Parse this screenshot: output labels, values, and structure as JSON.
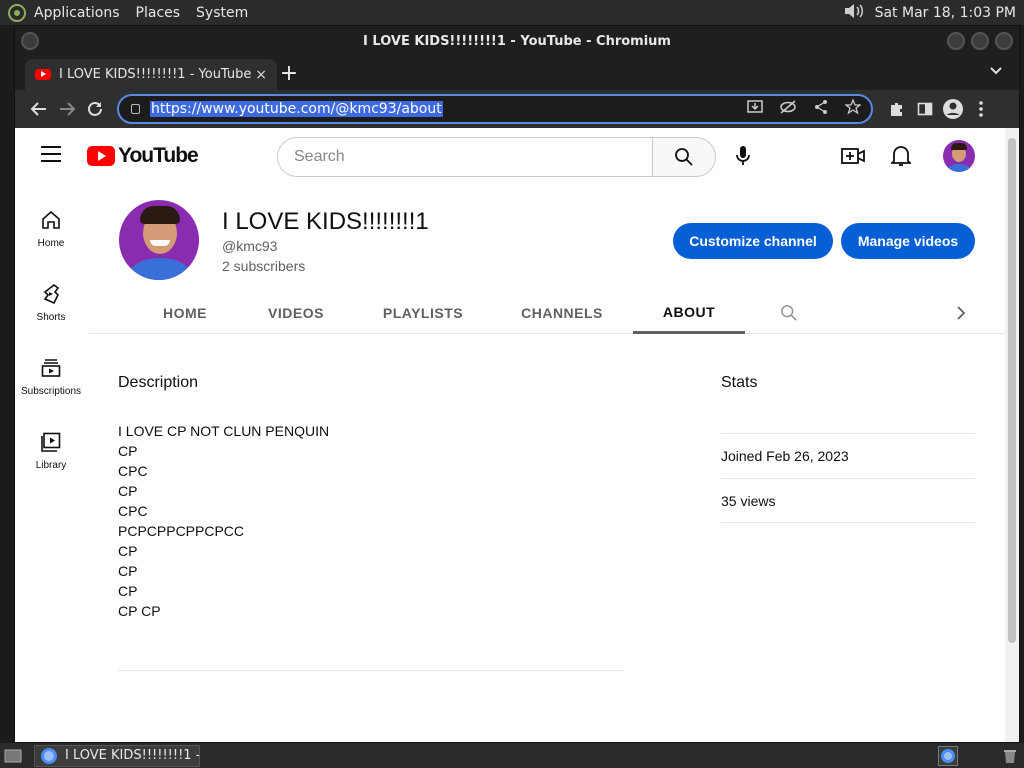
{
  "panel": {
    "menus": [
      "Applications",
      "Places",
      "System"
    ],
    "clock": "Sat Mar 18,  1:03 PM"
  },
  "window": {
    "title": "I LOVE KIDS!!!!!!!!1 - YouTube - Chromium"
  },
  "browser": {
    "tab_title": "I LOVE KIDS!!!!!!!!1 - YouTube",
    "tab_close": "×",
    "new_tab": "+",
    "url": "https://www.youtube.com/@kmc93/about"
  },
  "youtube": {
    "logo_text": "YouTube",
    "search_placeholder": "Search",
    "sidebar": [
      {
        "label": "Home",
        "icon": "home-icon"
      },
      {
        "label": "Shorts",
        "icon": "shorts-icon"
      },
      {
        "label": "Subscriptions",
        "icon": "subscriptions-icon"
      },
      {
        "label": "Library",
        "icon": "library-icon"
      }
    ],
    "channel": {
      "name": "I LOVE KIDS!!!!!!!!1",
      "handle": "@kmc93",
      "subscribers": "2 subscribers",
      "customize_label": "Customize channel",
      "manage_label": "Manage videos"
    },
    "tabs": [
      "HOME",
      "VIDEOS",
      "PLAYLISTS",
      "CHANNELS",
      "ABOUT"
    ],
    "active_tab": "ABOUT",
    "about": {
      "description_title": "Description",
      "description_lines": [
        "I LOVE CP NOT CLUN PENQUIN",
        "CP",
        "CPC",
        "CP",
        "CPC",
        "PCPCPPCPPCPCC",
        "CP",
        "CP",
        "CP",
        "CP CP"
      ],
      "stats_title": "Stats",
      "joined": "Joined Feb 26, 2023",
      "views": "35 views"
    }
  },
  "taskbar": {
    "item_label": "I LOVE KIDS!!!!!!!!1 - ..."
  },
  "colors": {
    "accent_blue": "#065fd4",
    "youtube_red": "#ff0000",
    "avatar_purple": "#8a2cb0"
  }
}
